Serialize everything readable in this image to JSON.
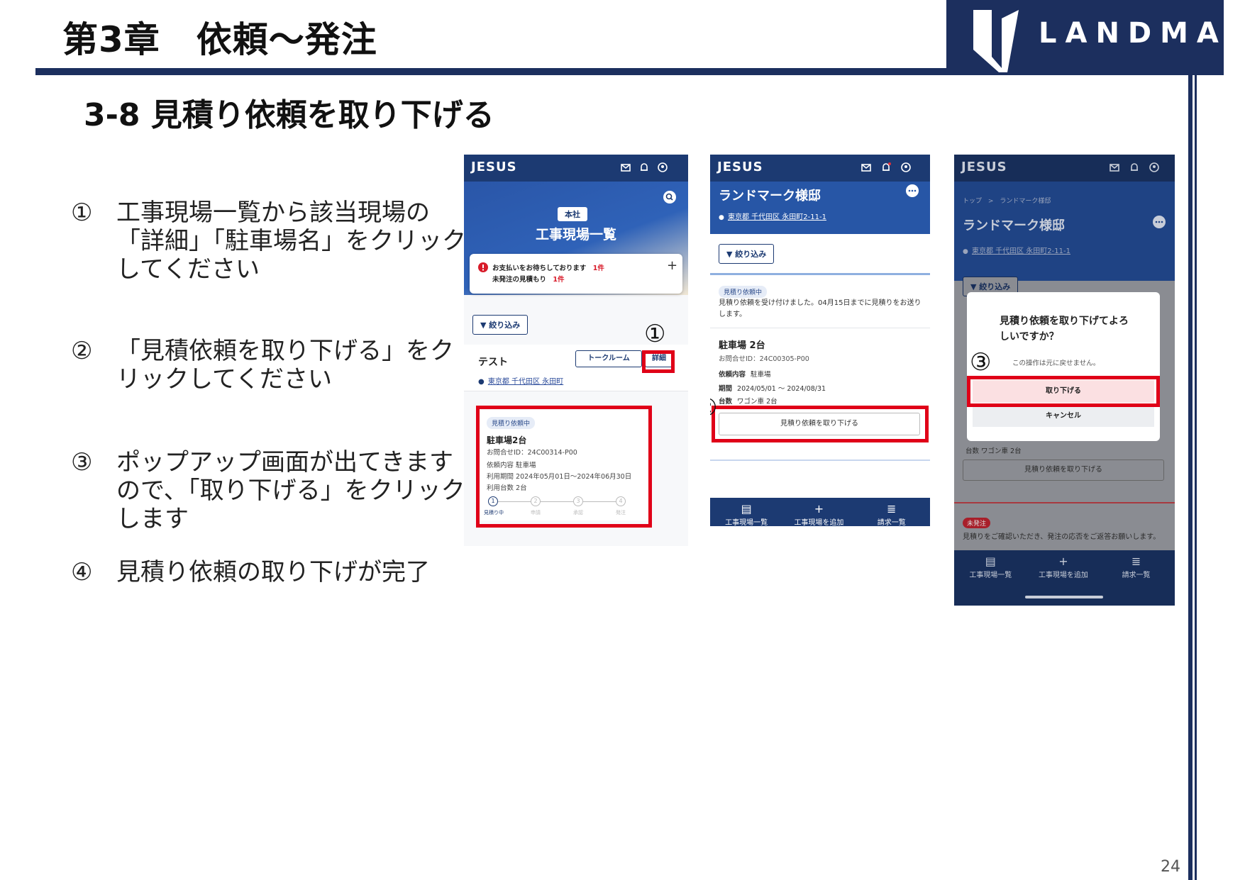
{
  "header": {
    "chapter_title": "第3章　依頼～発注",
    "logo_text": "LANDMARK",
    "brand_color": "#1c2f5e"
  },
  "section_title": "3-8 見積り依頼を取り下げる",
  "steps": [
    {
      "num": "①",
      "text": "工事現場一覧から該当現場の「詳細」「駐車場名」をクリックしてください"
    },
    {
      "num": "②",
      "text": "「見積依頼を取り下げる」をクリックしてください"
    },
    {
      "num": "③",
      "text": "ポップアップ画面が出てきますので、「取り下げる」をクリックします"
    },
    {
      "num": "④",
      "text": "見積り依頼の取り下げが完了"
    }
  ],
  "page_number": "24",
  "screen1": {
    "brand": "JESUS",
    "office_chip": "本社",
    "page_title": "工事現場一覧",
    "alert_line1": "お支払いをお待ちしております",
    "alert_count1": "1件",
    "alert_line2": "未発注の見積もり",
    "alert_count2": "1件",
    "plus": "+",
    "filter_label": "絞り込み",
    "site_name": "テスト",
    "talk_button": "トークルーム",
    "detail_button": "詳細",
    "site_address": "東京都 千代田区 永田町",
    "callout": "①",
    "card_tag": "見積り依頼中",
    "card_title": "駐車場2台",
    "card_id": "お問合せID：24C00314-P00",
    "card_content": "依頼内容 駐車場",
    "card_period": "利用期間 2024年05月01日～2024年06月30日",
    "card_count": "利用台数 2台",
    "progress_nums": [
      "1",
      "2",
      "3",
      "4"
    ],
    "progress_labels": [
      "見積り中",
      "申請",
      "承認",
      "発注"
    ]
  },
  "screen2": {
    "brand": "JESUS",
    "site_title": "ランドマーク様邸",
    "address": "東京都 千代田区 永田町2-11-1",
    "filter_label": "絞り込み",
    "status_tag": "見積り依頼中",
    "message": "見積り依頼を受け付けました。04月15日までに見積りをお送りします。",
    "parking_title": "駐車場 2台",
    "inquiry_id": "お問合せID：24C00305-P00",
    "content_label": "依頼内容",
    "content_value": "駐車場",
    "period_label": "期間",
    "period_value": "2024/05/01 ～ 2024/08/31",
    "count_label": "台数",
    "count_value": "ワゴン車 2台",
    "withdraw_button": "見積り依頼を取り下げる",
    "callout": "②",
    "nav": [
      "工事現場一覧",
      "工事現場を追加",
      "請求一覧"
    ]
  },
  "screen3": {
    "brand": "JESUS",
    "breadcrumb_top": "トップ",
    "breadcrumb_sep": ">",
    "breadcrumb_current": "ランドマーク様邸",
    "site_title": "ランドマーク様邸",
    "address": "東京都 千代田区 永田町2-11-1",
    "filter_label": "絞り込み",
    "dialog_title": "見積り依頼を取り下げてよろしいですか？",
    "dialog_note": "この操作は元に戻せません。",
    "confirm_button": "取り下げる",
    "cancel_button": "キャンセル",
    "bg_count": "台数 ワゴン車 2台",
    "bg_withdraw_button": "見積り依頼を取り下げる",
    "unordered_tag": "未発注",
    "bg_message": "見積りをご確認いただき、発注の応否をご返答お願いします。",
    "callout": "③",
    "nav": [
      "工事現場一覧",
      "工事現場を追加",
      "請求一覧"
    ]
  }
}
